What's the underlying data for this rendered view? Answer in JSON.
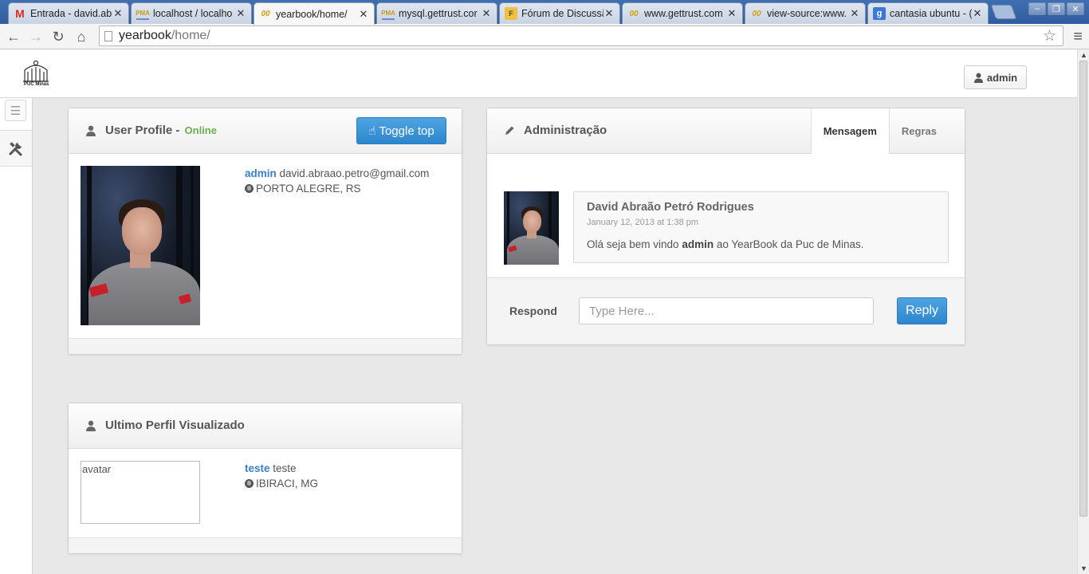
{
  "browser": {
    "tabs": [
      {
        "title": "Entrada - david.abr",
        "favicon": "gmail-icon",
        "glyph": "M"
      },
      {
        "title": "localhost / localho",
        "favicon": "phpmyadmin-icon",
        "glyph": "PMA"
      },
      {
        "title": "yearbook/home/",
        "favicon": "wordpress-icon",
        "glyph": "00"
      },
      {
        "title": "mysql.gettrust.cor",
        "favicon": "phpmyadmin-icon",
        "glyph": "PMA"
      },
      {
        "title": "Fórum de Discussã",
        "favicon": "forum-icon",
        "glyph": "F"
      },
      {
        "title": "www.gettrust.com",
        "favicon": "wordpress-icon",
        "glyph": "00"
      },
      {
        "title": "view-source:www.",
        "favicon": "wordpress-icon",
        "glyph": "00"
      },
      {
        "title": "cantasia ubuntu - (",
        "favicon": "google-icon",
        "glyph": "g"
      }
    ],
    "active_tab": 2,
    "url_host": "yearbook",
    "url_path": "/home/"
  },
  "header": {
    "logo_text": "PUC Minas",
    "user_button": "admin"
  },
  "profile": {
    "title": "User Profile - ",
    "status": "Online",
    "toggle_button": "Toggle top",
    "username": "admin",
    "email": "david.abraao.petro@gmail.com",
    "location": "PORTO ALEGRE, RS"
  },
  "last_viewed": {
    "title": "Ultimo Perfil Visualizado",
    "avatar_alt": "avatar",
    "username": "teste",
    "name": "teste",
    "location": "IBIRACI, MG"
  },
  "admin_panel": {
    "title": "Administração",
    "tabs": [
      "Mensagem",
      "Regras"
    ],
    "active_tab": "Mensagem",
    "message": {
      "author": "David Abraão Petró Rodrigues",
      "date": "January 12, 2013 at 1:38 pm",
      "text_before": "Olá seja bem vindo ",
      "text_bold": "admin",
      "text_after": " ao YearBook da Puc de Minas."
    },
    "respond_label": "Respond",
    "reply_placeholder": "Type Here...",
    "reply_button": "Reply"
  },
  "colors": {
    "accent": "#2d86cc",
    "online": "#68b04d",
    "link": "#3a7fc1"
  }
}
